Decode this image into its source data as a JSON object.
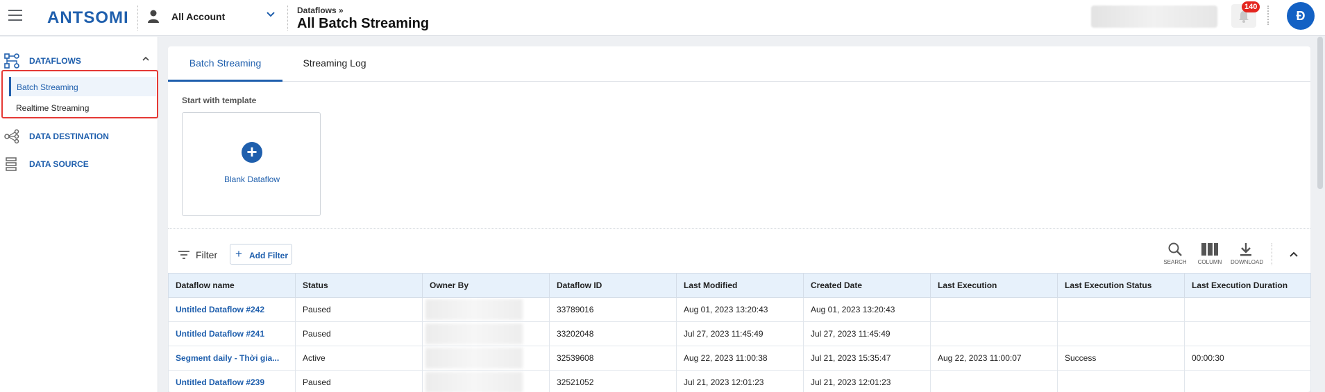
{
  "header": {
    "logo": "ANTSOMI",
    "account_label": "All Account",
    "breadcrumb": "Dataflows »",
    "title": "All Batch Streaming",
    "notification_count": "140",
    "avatar_initial": "Đ"
  },
  "sidebar": {
    "groups": [
      {
        "label": "DATAFLOWS",
        "icon": "dataflow-icon"
      },
      {
        "label": "DATA DESTINATION",
        "icon": "share-nodes-icon"
      },
      {
        "label": "DATA SOURCE",
        "icon": "database-list-icon"
      }
    ],
    "subitems": [
      {
        "label": "Batch Streaming",
        "active": true
      },
      {
        "label": "Realtime Streaming",
        "active": false
      }
    ]
  },
  "tabs": [
    {
      "label": "Batch Streaming",
      "active": true
    },
    {
      "label": "Streaming Log",
      "active": false
    }
  ],
  "template": {
    "heading": "Start with template",
    "card_label": "Blank Dataflow"
  },
  "toolbar": {
    "filter_label": "Filter",
    "add_filter_label": "Add Filter",
    "search_label": "SEARCH",
    "column_label": "COLUMN",
    "download_label": "DOWNLOAD"
  },
  "table": {
    "columns": [
      "Dataflow name",
      "Status",
      "Owner By",
      "Dataflow ID",
      "Last Modified",
      "Created Date",
      "Last Execution",
      "Last Execution Status",
      "Last Execution Duration"
    ],
    "rows": [
      [
        "Untitled Dataflow #242",
        "Paused",
        "",
        "33789016",
        "Aug 01, 2023 13:20:43",
        "Aug 01, 2023 13:20:43",
        "",
        "",
        ""
      ],
      [
        "Untitled Dataflow #241",
        "Paused",
        "",
        "33202048",
        "Jul 27, 2023 11:45:49",
        "Jul 27, 2023 11:45:49",
        "",
        "",
        ""
      ],
      [
        "Segment daily - Thời gia...",
        "Active",
        "",
        "32539608",
        "Aug 22, 2023 11:00:38",
        "Jul 21, 2023 15:35:47",
        "Aug 22, 2023 11:00:07",
        "Success",
        "00:00:30"
      ],
      [
        "Untitled Dataflow #239",
        "Paused",
        "",
        "32521052",
        "Jul 21, 2023 12:01:23",
        "Jul 21, 2023 12:01:23",
        "",
        "",
        ""
      ]
    ]
  },
  "colors": {
    "primary": "#1f5fad",
    "highlight_border": "#e53935",
    "badge": "#e4261f",
    "table_header_bg": "#e7f1fb"
  }
}
